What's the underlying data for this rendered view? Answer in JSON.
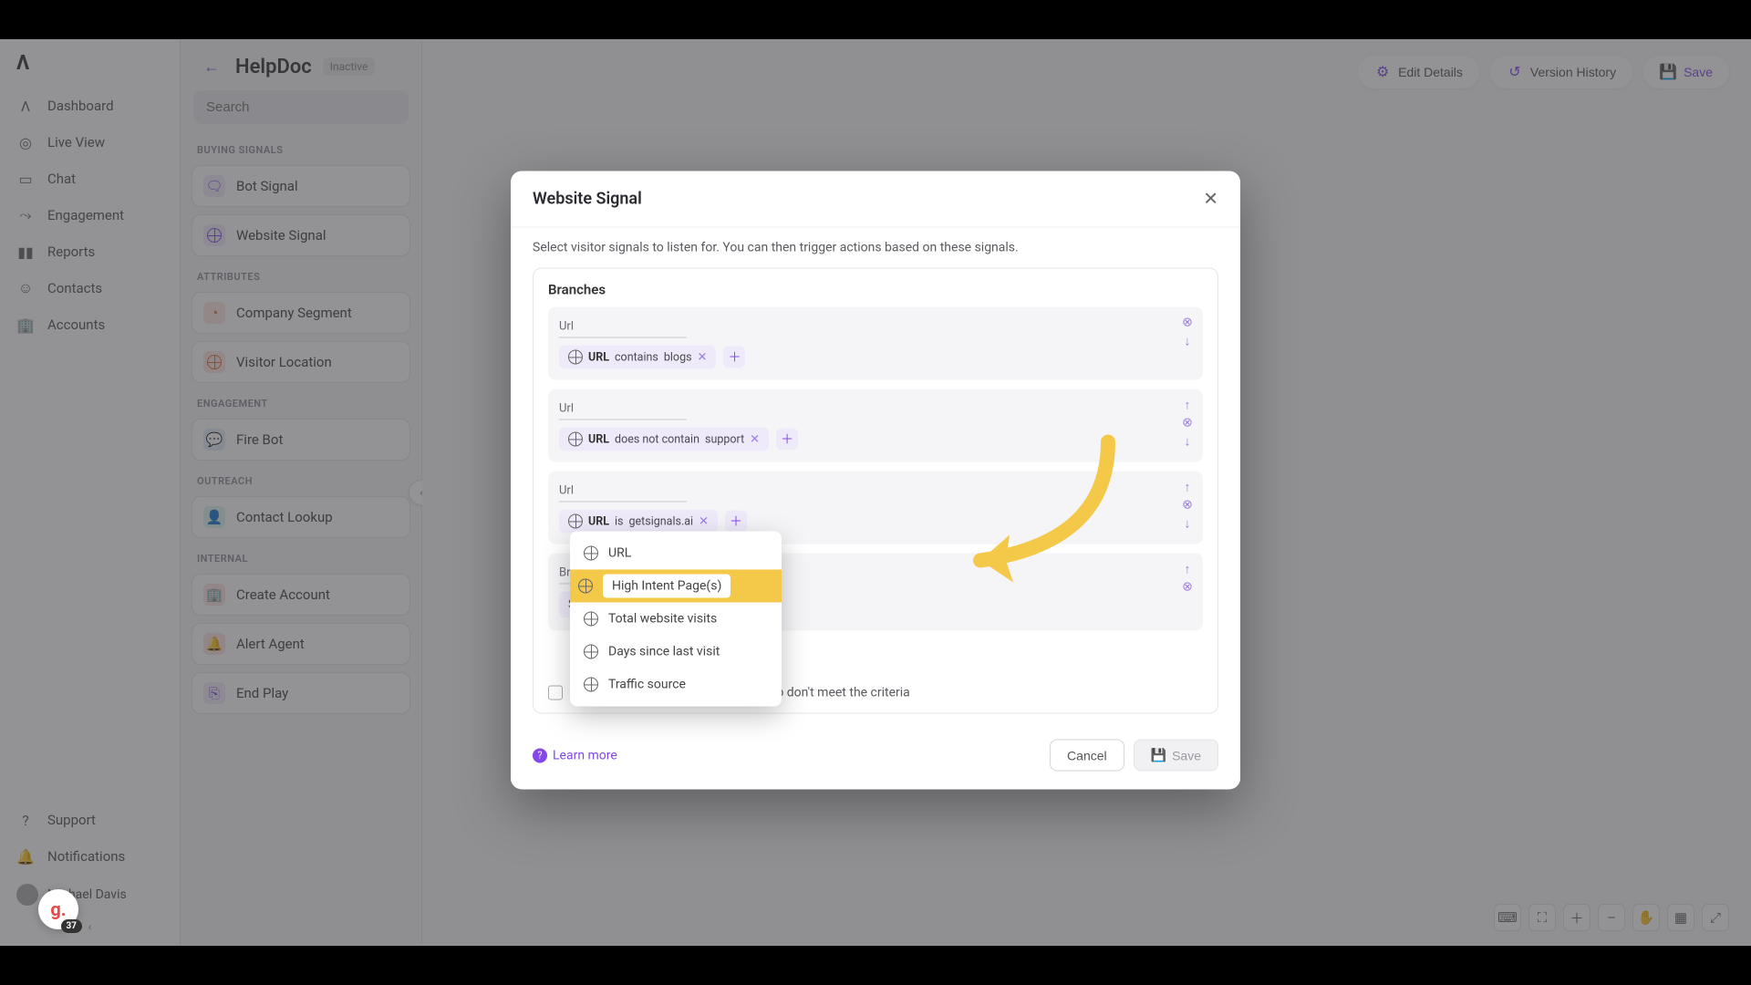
{
  "sidebar": {
    "items": [
      {
        "label": "Dashboard",
        "icon": "logo"
      },
      {
        "label": "Live View",
        "icon": "target"
      },
      {
        "label": "Chat",
        "icon": "chat"
      },
      {
        "label": "Engagement",
        "icon": "path"
      },
      {
        "label": "Reports",
        "icon": "bars"
      },
      {
        "label": "Contacts",
        "icon": "person"
      },
      {
        "label": "Accounts",
        "icon": "building"
      }
    ],
    "footer": {
      "support": "Support",
      "notifications": "Notifications",
      "user_name": "Michael Davis"
    }
  },
  "g_widget": {
    "glyph": "g.",
    "badge": "37"
  },
  "panel2": {
    "back": "←",
    "title": "HelpDoc",
    "status": "Inactive",
    "search_placeholder": "Search",
    "groups": {
      "buying_signals": "BUYING SIGNALS",
      "attributes": "ATTRIBUTES",
      "engagement": "ENGAGEMENT",
      "outreach": "OUTREACH",
      "internal": "INTERNAL"
    },
    "buying_signals": [
      {
        "label": "Bot Signal",
        "color": "purple"
      },
      {
        "label": "Website Signal",
        "color": "purple"
      }
    ],
    "attributes": [
      {
        "label": "Company Segment",
        "color": "orange"
      },
      {
        "label": "Visitor Location",
        "color": "orange"
      }
    ],
    "engagement": [
      {
        "label": "Fire Bot",
        "color": "blue"
      }
    ],
    "outreach": [
      {
        "label": "Contact Lookup",
        "color": "teal"
      }
    ],
    "internal": [
      {
        "label": "Create Account",
        "color": "red"
      },
      {
        "label": "Alert Agent",
        "color": "red"
      },
      {
        "label": "End Play",
        "color": "purple"
      }
    ]
  },
  "toolbar": {
    "edit": "Edit Details",
    "history": "Version History",
    "save": "Save"
  },
  "modal": {
    "title": "Website Signal",
    "subtitle": "Select visitor signals to listen for. You can then trigger actions based on these signals.",
    "branches_label": "Branches",
    "rows": [
      {
        "label": "Url",
        "chip_field": "URL",
        "chip_op": "contains",
        "chip_val": "blogs",
        "actions": [
          "remove",
          "down"
        ]
      },
      {
        "label": "Url",
        "chip_field": "URL",
        "chip_op": "does not contain",
        "chip_val": "support",
        "actions": [
          "up",
          "remove",
          "down"
        ]
      },
      {
        "label": "Url",
        "chip_field": "URL",
        "chip_op": "is",
        "chip_val": "getsignals.ai",
        "actions": [
          "up",
          "remove",
          "down"
        ]
      }
    ],
    "branch_label_row": {
      "label": "Branch Label",
      "select_filter_text": "Select Filter",
      "actions": [
        "up",
        "remove"
      ]
    },
    "fallback": "Add a fallback branch for visitors who don't meet the criteria",
    "learn_more": "Learn more",
    "cancel": "Cancel",
    "save": "Save"
  },
  "dropdown": {
    "items": [
      "URL",
      "High Intent Page(s)",
      "Total website visits",
      "Days since last visit",
      "Traffic source"
    ],
    "highlight_index": 1
  },
  "bottom_toolbar_icons": [
    "keyboard",
    "select",
    "zoom-in",
    "zoom-out",
    "pan",
    "fit",
    "fullscreen"
  ]
}
